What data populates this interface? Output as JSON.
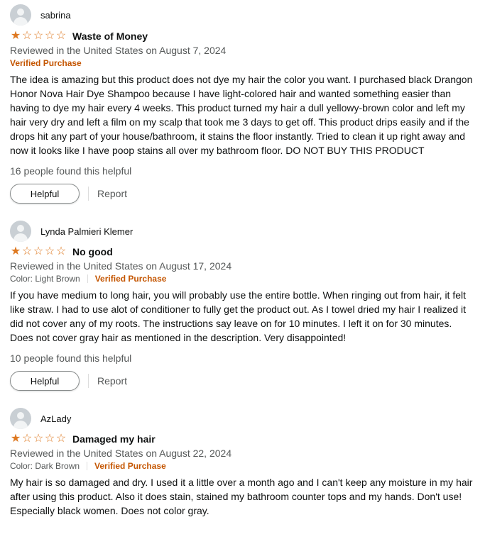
{
  "reviews": [
    {
      "reviewer": "sabrina",
      "rating": 1,
      "title": "Waste of Money",
      "date": "Reviewed in the United States on August 7, 2024",
      "color": "",
      "verified": "Verified Purchase",
      "body": "The idea is amazing but this product does not dye my hair the color you want. I purchased black Drangon Honor Nova Hair Dye Shampoo because I have light-colored hair and wanted something easier than having to dye my hair every 4 weeks. This product turned my hair a dull yellowy-brown color and left my hair very dry and left a film on my scalp that took me 3 days to get off. This product drips easily and if the drops hit any part of your house/bathroom, it stains the floor instantly. Tried to clean it up right away and now it looks like I have poop stains all over my bathroom floor. DO NOT BUY THIS PRODUCT",
      "helpful_count": "16 people found this helpful",
      "helpful_label": "Helpful",
      "report_label": "Report"
    },
    {
      "reviewer": "Lynda Palmieri Klemer",
      "rating": 1,
      "title": "No good",
      "date": "Reviewed in the United States on August 17, 2024",
      "color": "Color: Light Brown",
      "verified": "Verified Purchase",
      "body": "If you have medium to long hair, you will probably use the entire bottle. When ringing out from hair, it felt like straw. I had to use alot of conditioner to fully get the product out. As I towel dried my hair I realized it did not cover any of my roots. The instructions say leave on for 10 minutes. I left it on for 30 minutes. Does not cover gray hair as mentioned in the description. Very disappointed!",
      "helpful_count": "10 people found this helpful",
      "helpful_label": "Helpful",
      "report_label": "Report"
    },
    {
      "reviewer": "AzLady",
      "rating": 1,
      "title": "Damaged my hair",
      "date": "Reviewed in the United States on August 22, 2024",
      "color": "Color: Dark Brown",
      "verified": "Verified Purchase",
      "body": "My hair is so damaged and dry. I used it a little over a month ago and I can't keep any moisture in my hair after using this product. Also it does stain, stained my bathroom counter tops and my hands. Don't use! Especially black women. Does not color gray.",
      "helpful_count": "",
      "helpful_label": "",
      "report_label": ""
    }
  ],
  "icons": {
    "avatar": "user-avatar-icon",
    "star_full": "star-filled-icon",
    "star_empty": "star-outline-icon"
  },
  "colors": {
    "star": "#de7921",
    "verified": "#c45500",
    "secondary_text": "#565959"
  }
}
